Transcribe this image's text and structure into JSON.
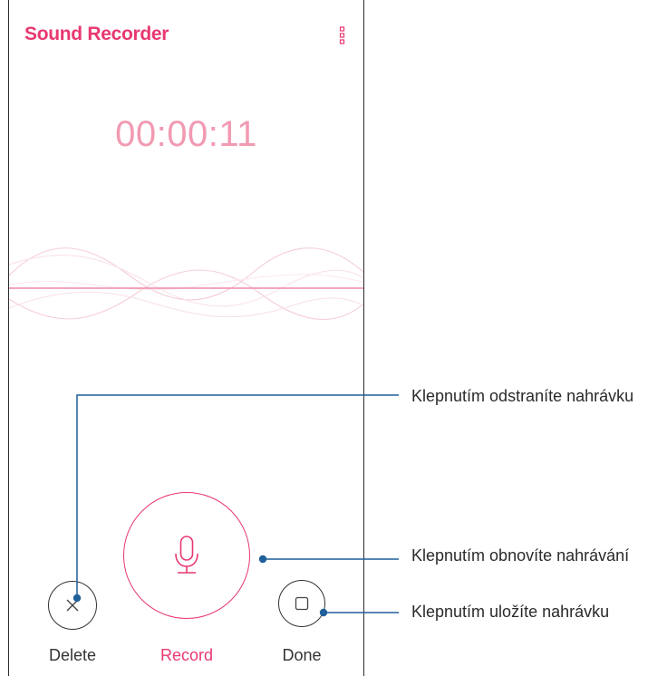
{
  "app": {
    "title": "Sound Recorder",
    "menu_icon": "more-vertical-icon"
  },
  "recording": {
    "elapsed_time": "00:00:11"
  },
  "controls": {
    "delete": {
      "label": "Delete",
      "icon": "close-icon"
    },
    "record": {
      "label": "Record",
      "icon": "microphone-icon"
    },
    "done": {
      "label": "Done",
      "icon": "stop-icon"
    }
  },
  "callouts": [
    {
      "text": "Klepnutím odstraníte nahrávku"
    },
    {
      "text": "Klepnutím obnovíte nahrávání"
    },
    {
      "text": "Klepnutím uložíte nahrávku"
    }
  ],
  "colors": {
    "accent": "#e8386f",
    "timer": "#f29ab2",
    "callout_line": "#1f5f9a"
  }
}
